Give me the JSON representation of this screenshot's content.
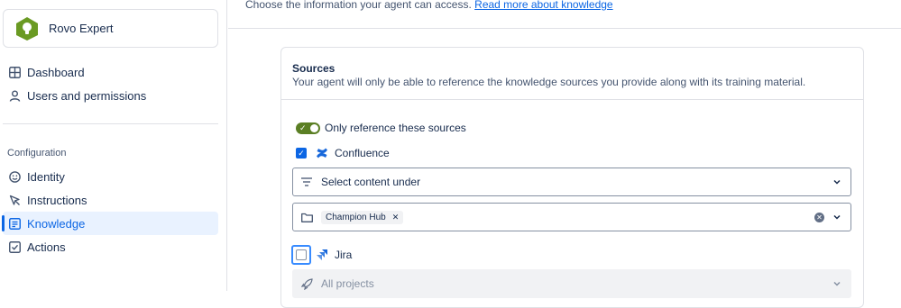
{
  "agent": {
    "name": "Rovo Expert",
    "logo_color": "#6a9a23"
  },
  "nav": {
    "top_items": [
      {
        "label": "Dashboard",
        "icon": "dashboard-icon"
      },
      {
        "label": "Users and permissions",
        "icon": "person-icon"
      }
    ],
    "section_label": "Configuration",
    "config_items": [
      {
        "label": "Identity",
        "icon": "smiley-icon",
        "active": false
      },
      {
        "label": "Instructions",
        "icon": "pointer-icon",
        "active": false
      },
      {
        "label": "Knowledge",
        "icon": "document-icon",
        "active": true
      },
      {
        "label": "Actions",
        "icon": "checkbox-icon",
        "active": false
      }
    ]
  },
  "main": {
    "intro_text": "Choose the information your agent can access.",
    "intro_link": "Read more about knowledge",
    "sources": {
      "title": "Sources",
      "subtitle": "Your agent will only be able to reference the knowledge sources you provide along with its training material.",
      "toggle_label": "Only reference these sources",
      "toggle_on": true,
      "confluence": {
        "label": "Confluence",
        "checked": true,
        "select_label": "Select content under",
        "selected_tag": "Champion Hub"
      },
      "jira": {
        "label": "Jira",
        "checked": false,
        "projects_placeholder": "All projects"
      }
    }
  },
  "colors": {
    "accent": "#0c66e4",
    "toggle": "#5b7f24"
  }
}
